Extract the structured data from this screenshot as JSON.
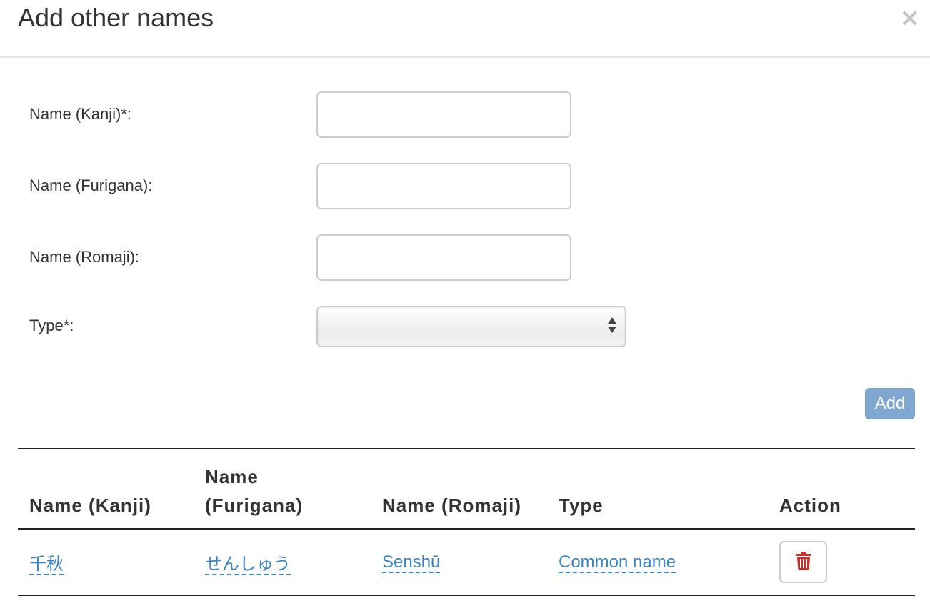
{
  "modal": {
    "title": "Add other names",
    "close_label": "×"
  },
  "form": {
    "kanji_label": "Name (Kanji)*:",
    "kanji_value": "",
    "furigana_label": "Name (Furigana):",
    "furigana_value": "",
    "romaji_label": "Name (Romaji):",
    "romaji_value": "",
    "type_label": "Type*:",
    "type_selected": "",
    "add_label": "Add"
  },
  "table": {
    "headers": {
      "kanji": "Name (Kanji)",
      "furigana_line1": "Name",
      "furigana_line2": "(Furigana)",
      "romaji": "Name (Romaji)",
      "type": "Type",
      "action": "Action"
    },
    "rows": [
      {
        "kanji": "千秋",
        "furigana": "せんしゅう",
        "romaji": "Senshū",
        "type": "Common name",
        "action_icon": "trash-icon"
      }
    ]
  },
  "colors": {
    "link": "#3c84c3",
    "add_button": "#7fa7d0",
    "delete_icon": "#cc2f2a"
  }
}
